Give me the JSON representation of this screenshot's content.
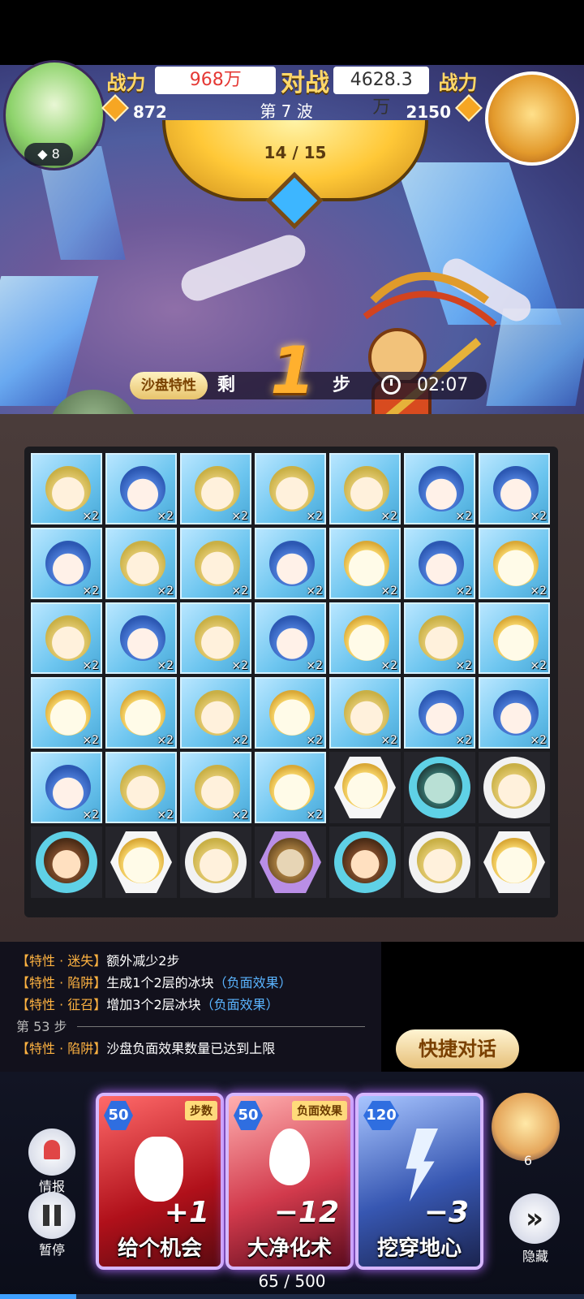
{
  "hud": {
    "power_label_left": "战力",
    "power_left": "968万",
    "vs_label": "对战",
    "power_right": "4628.3万",
    "power_label_right": "战力",
    "score_left": "872",
    "wave": "第 7 波",
    "score_right": "2150",
    "avatar_left_level": "8",
    "progress": "14 / 15"
  },
  "battle_info": {
    "sandbox_tag": "沙盘特性",
    "remaining_label": "剩",
    "steps_value": "1",
    "step_unit": "步",
    "timer": "02:07"
  },
  "board": {
    "rows": [
      [
        {
          "face": "green",
          "ice": true,
          "mult": "×2"
        },
        {
          "face": "blue",
          "ice": true,
          "mult": "×2"
        },
        {
          "face": "green",
          "ice": true,
          "mult": "×2"
        },
        {
          "face": "green",
          "ice": true,
          "mult": "×2"
        },
        {
          "face": "green",
          "ice": true,
          "mult": "×2"
        },
        {
          "face": "blue",
          "ice": true,
          "mult": "×2"
        },
        {
          "face": "blue",
          "ice": true,
          "mult": "×2"
        }
      ],
      [
        {
          "face": "blue",
          "ice": true,
          "mult": "×2"
        },
        {
          "face": "green",
          "ice": true,
          "mult": "×2"
        },
        {
          "face": "green",
          "ice": true,
          "mult": "×2"
        },
        {
          "face": "blue",
          "ice": true,
          "mult": "×2"
        },
        {
          "face": "yellow",
          "ice": true,
          "mult": "×2"
        },
        {
          "face": "blue",
          "ice": true,
          "mult": "×2"
        },
        {
          "face": "yellow",
          "ice": true,
          "mult": "×2"
        }
      ],
      [
        {
          "face": "green",
          "ice": true,
          "mult": "×2"
        },
        {
          "face": "blue",
          "ice": true,
          "mult": "×2"
        },
        {
          "face": "green",
          "ice": true,
          "mult": "×2"
        },
        {
          "face": "blue",
          "ice": true,
          "mult": "×2"
        },
        {
          "face": "yellow",
          "ice": true,
          "mult": "×2"
        },
        {
          "face": "green",
          "ice": true,
          "mult": "×2"
        },
        {
          "face": "yellow",
          "ice": true,
          "mult": "×2"
        }
      ],
      [
        {
          "face": "yellow",
          "ice": true,
          "mult": "×2"
        },
        {
          "face": "yellow",
          "ice": true,
          "mult": "×2"
        },
        {
          "face": "green",
          "ice": true,
          "mult": "×2"
        },
        {
          "face": "yellow",
          "ice": true,
          "mult": "×2"
        },
        {
          "face": "green",
          "ice": true,
          "mult": "×2"
        },
        {
          "face": "blue",
          "ice": true,
          "mult": "×2"
        },
        {
          "face": "blue",
          "ice": true,
          "mult": "×2"
        }
      ],
      [
        {
          "face": "blue",
          "ice": true,
          "mult": "×2"
        },
        {
          "face": "green",
          "ice": true,
          "mult": "×2"
        },
        {
          "face": "green",
          "ice": true,
          "mult": "×2"
        },
        {
          "face": "yellow",
          "ice": true,
          "mult": "×2"
        },
        {
          "face": "yellow",
          "ice": false,
          "plate": "hex"
        },
        {
          "face": "mask",
          "ice": false,
          "plate": "cyan"
        },
        {
          "face": "green",
          "ice": false,
          "plate": "white"
        }
      ],
      [
        {
          "face": "monkey",
          "ice": false,
          "plate": "cyan"
        },
        {
          "face": "yellow",
          "ice": false,
          "plate": "hex"
        },
        {
          "face": "green",
          "ice": false,
          "plate": "white"
        },
        {
          "face": "owl",
          "ice": false,
          "plate": "purple"
        },
        {
          "face": "monkey",
          "ice": false,
          "plate": "cyan"
        },
        {
          "face": "green",
          "ice": false,
          "plate": "white"
        },
        {
          "face": "yellow",
          "ice": false,
          "plate": "hex"
        }
      ]
    ]
  },
  "log": {
    "lines": [
      {
        "tag": "【特性 · 迷失】",
        "text": "额外减少2步",
        "neg": ""
      },
      {
        "tag": "【特性 · 陷阱】",
        "text": "生成1个2层的冰块",
        "neg": "（负面效果）"
      },
      {
        "tag": "【特性 · 征召】",
        "text": "增加3个2层冰块",
        "neg": "（负面效果）"
      }
    ],
    "separator": "第 53 步",
    "last_line": {
      "tag": "【特性 · 陷阱】",
      "text": "沙盘负面效果数量已达到上限"
    }
  },
  "quick_chat": "快捷对话",
  "side": {
    "info_label": "情报",
    "pause_label": "暂停",
    "hide_label": "隐藏",
    "avatar_count": "6"
  },
  "cards": [
    {
      "cost": "50",
      "tag": "步数",
      "value": "+1",
      "name": "给个机会"
    },
    {
      "cost": "50",
      "tag": "负面效果",
      "value": "−12",
      "name": "大净化术"
    },
    {
      "cost": "120",
      "tag": "",
      "value": "−3",
      "name": "挖穿地心"
    }
  ],
  "energy": {
    "text": "65 / 500",
    "fraction": 0.13
  },
  "colors": {
    "accent_gold": "#ffd86a",
    "power_red": "#e53935",
    "negative_blue": "#5ab4ff",
    "tag_orange": "#ffb341"
  }
}
